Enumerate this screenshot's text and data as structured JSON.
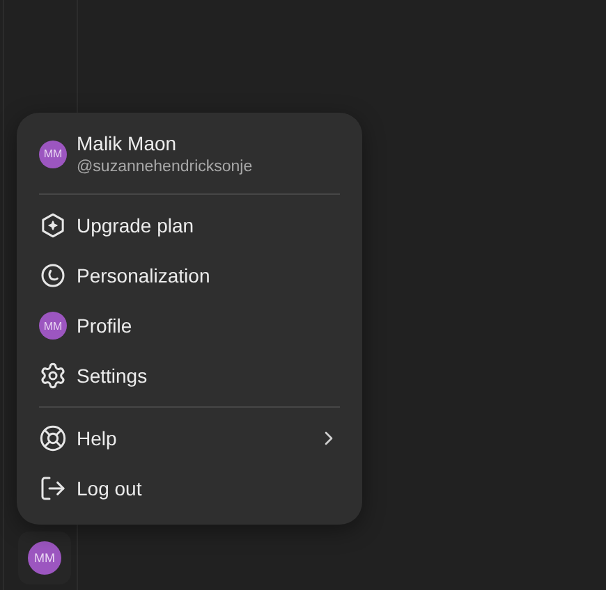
{
  "account_menu": {
    "user": {
      "initials": "MM",
      "name": "Malik Maon",
      "handle": "@suzannehendricksonje"
    },
    "sections": [
      [
        {
          "kind": "upgrade",
          "label": "Upgrade plan",
          "submenu": false
        },
        {
          "kind": "personalization",
          "label": "Personalization",
          "submenu": false
        },
        {
          "kind": "avatar",
          "initials": "MM",
          "label": "Profile",
          "submenu": false
        },
        {
          "kind": "settings",
          "label": "Settings",
          "submenu": false
        }
      ],
      [
        {
          "kind": "help",
          "label": "Help",
          "submenu": true
        },
        {
          "kind": "logout",
          "label": "Log out",
          "submenu": false
        }
      ]
    ]
  },
  "sidebar": {
    "avatar_initials": "MM"
  }
}
